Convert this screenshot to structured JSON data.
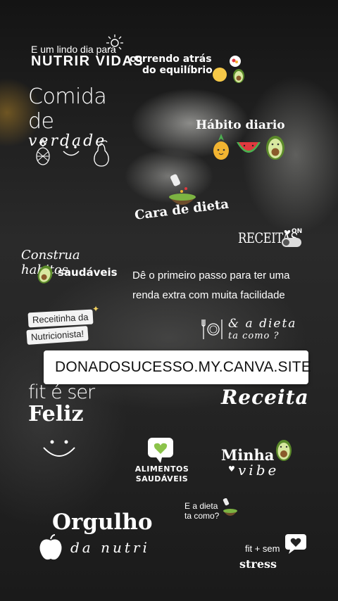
{
  "stickers": {
    "lindo_dia_line1": "E um lindo dia para",
    "lindo_dia_line2": "NUTRIR VIDAS",
    "correndo_line1": "correndo atrás",
    "correndo_line2": "do equilíbrio",
    "comida_line1": "Comida de",
    "comida_line2": "verdade",
    "habito": "Hábito diario",
    "cara_dieta": "Cara de dieta",
    "receitas": "RECEITAS",
    "toggle_label": "ON",
    "construa_line1": "Construa habitos",
    "construa_line2": "saudáveis",
    "promo_line1": "Dê o primeiro passo para ter uma",
    "promo_line2": "renda extra com muita facilidade",
    "receitinha_line1": "Receitinha da",
    "receitinha_line2": "Nutricionista!",
    "dieta_line1": "& a dieta",
    "dieta_line2": "ta como ?",
    "fit_line1": "fit é ser",
    "fit_line2": "Feliz",
    "receita": "Receita",
    "alimentos_line1": "ALIMENTOS",
    "alimentos_line2": "SAUDÁVEIS",
    "minha": "Minha",
    "vibe": "vibe",
    "dieta2_line1": "E a dieta",
    "dieta2_line2": "ta como?",
    "orgulho": "Orgulho",
    "da_nutri": "da nutri",
    "fit_sem": "fit + sem",
    "stress": "stress"
  },
  "link": {
    "url": "DONADOSUCESSO.MY.CANVA.SITE"
  },
  "colors": {
    "pineapple": "#f2b431",
    "watermelon": "#e0393e",
    "avocado": "#7cb342",
    "accent_green": "#8bc34a"
  }
}
